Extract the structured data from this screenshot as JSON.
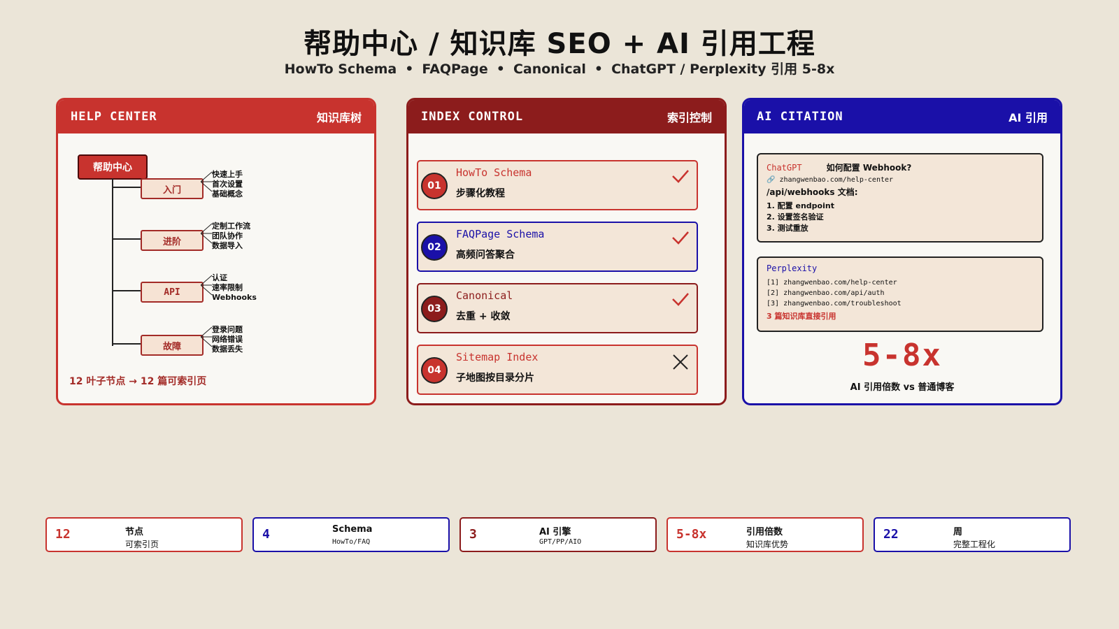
{
  "header": {
    "title": "帮助中心 / 知识库 SEO + AI 引用工程",
    "subtitle_items": [
      "HowTo Schema",
      "FAQPage",
      "Canonical",
      "ChatGPT / Perplexity 引用 5-8x"
    ],
    "subtitle_sep": "•"
  },
  "help_center": {
    "title_en": "HELP CENTER",
    "title_zh": "知识库树",
    "root": "帮助中心",
    "branches": [
      {
        "label": "入门",
        "leaves": [
          "快速上手",
          "首次设置",
          "基础概念"
        ]
      },
      {
        "label": "进阶",
        "leaves": [
          "定制工作流",
          "团队协作",
          "数据导入"
        ]
      },
      {
        "label": "API",
        "leaves": [
          "认证",
          "速率限制",
          "Webhooks"
        ]
      },
      {
        "label": "故障",
        "leaves": [
          "登录问题",
          "网络错误",
          "数据丢失"
        ]
      }
    ],
    "footer": "12 叶子节点 → 12 篇可索引页"
  },
  "index_control": {
    "title_en": "INDEX CONTROL",
    "title_zh": "索引控制",
    "items": [
      {
        "num": "01",
        "title": "HowTo Schema",
        "desc": "步骤化教程",
        "status": "check"
      },
      {
        "num": "02",
        "title": "FAQPage Schema",
        "desc": "高频问答聚合",
        "status": "check"
      },
      {
        "num": "03",
        "title": "Canonical",
        "desc": "去重 + 收敛",
        "status": "check"
      },
      {
        "num": "04",
        "title": "Sitemap Index",
        "desc": "子地图按目录分片",
        "status": "cross"
      }
    ]
  },
  "ai_citation": {
    "title_en": "AI CITATION",
    "title_zh": "AI 引用",
    "chatgpt": {
      "source": "ChatGPT",
      "question": "如何配置 Webhook?",
      "link": "🔗 zhangwenbao.com/help-center",
      "doc": "/api/webhooks 文档:",
      "steps": [
        "1. 配置 endpoint",
        "2. 设置签名验证",
        "3. 测试重放"
      ]
    },
    "perplexity": {
      "source": "Perplexity",
      "refs": [
        "[1] zhangwenbao.com/help-center",
        "[2] zhangwenbao.com/api/auth",
        "[3] zhangwenbao.com/troubleshoot"
      ],
      "note": "3 篇知识库直接引用"
    },
    "stat": "5-8x",
    "stat_caption": "AI 引用倍数 vs 普通博客"
  },
  "stats": [
    {
      "value": "12",
      "label": "节点",
      "sub": "可索引页"
    },
    {
      "value": "4",
      "label": "Schema",
      "sub": "HowTo/FAQ"
    },
    {
      "value": "3",
      "label": "AI 引擎",
      "sub": "GPT/PP/AIO"
    },
    {
      "value": "5-8x",
      "label": "引用倍数",
      "sub": "知识库优势"
    },
    {
      "value": "22",
      "label": "周",
      "sub": "完整工程化"
    }
  ],
  "colors": {
    "red": "#c8332e",
    "dark_red": "#8c1c1c",
    "blue": "#1a10a8",
    "bg": "#ebe5d8"
  }
}
